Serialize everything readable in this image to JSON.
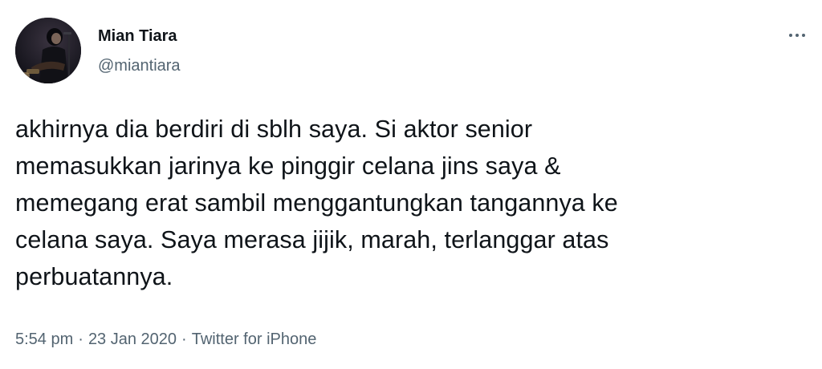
{
  "author": {
    "display_name": "Mian Tiara",
    "handle": "@miantiara"
  },
  "tweet": {
    "text": "akhirnya dia berdiri di sblh saya. Si aktor senior\nmemasukkan jarinya ke pinggir celana jins saya &\nmemegang erat sambil menggantungkan tangannya ke\ncelana saya. Saya merasa jijik, marah, terlanggar atas\nperbuatannya.",
    "time": "5:54 pm",
    "separator": "·",
    "date": "23 Jan 2020",
    "source": "Twitter for iPhone"
  },
  "icons": {
    "more": "more-options-icon"
  },
  "colors": {
    "primary_text": "#0f1419",
    "secondary_text": "#536471",
    "background": "#ffffff"
  }
}
